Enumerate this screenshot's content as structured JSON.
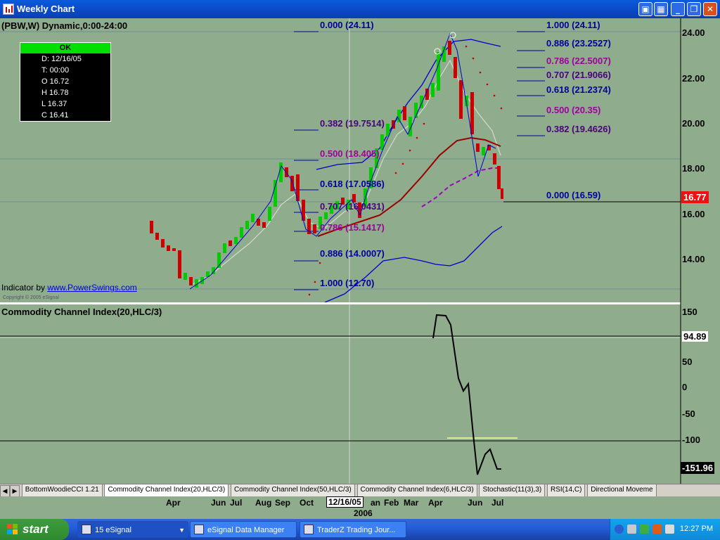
{
  "window": {
    "title": "Weekly Chart"
  },
  "chart": {
    "symbol_label": "(PBW,W) Dynamic,0:00-24:00",
    "indicator_credit": "Indicator by",
    "indicator_link": "www.PowerSwings.com",
    "copyright": "Copyright © 2005 eSignal",
    "ok_box": {
      "header": "OK",
      "lines": [
        "D: 12/16/05",
        "T: 00:00",
        "O 16.72",
        "H 16.78",
        "L 16.37",
        "C 16.41"
      ]
    },
    "price_axis_labels": [
      "24.00",
      "22.00",
      "20.00",
      "18.00",
      "16.00",
      "14.00"
    ],
    "current_price": "16.77",
    "fib_left": [
      {
        "label": "0.000 (24.11)",
        "color": "#0000A0"
      },
      {
        "label": "0.382 (19.7514)",
        "color": "#4B0082"
      },
      {
        "label": "0.500 (18.405)",
        "color": "#A000A0"
      },
      {
        "label": "0.618 (17.0586)",
        "color": "#0000A0"
      },
      {
        "label": "0.707 (16.0431)",
        "color": "#4B0082"
      },
      {
        "label": "0.786 (15.1417)",
        "color": "#A000A0"
      },
      {
        "label": "0.886 (14.0007)",
        "color": "#0000A0"
      },
      {
        "label": "1.000 (12.70)",
        "color": "#0000A0"
      }
    ],
    "fib_right": [
      {
        "label": "1.000 (24.11)",
        "color": "#0000A0"
      },
      {
        "label": "0.886 (23.2527)",
        "color": "#0000A0"
      },
      {
        "label": "0.786 (22.5007)",
        "color": "#A000A0"
      },
      {
        "label": "0.707 (21.9066)",
        "color": "#4B0082"
      },
      {
        "label": "0.618 (21.2374)",
        "color": "#0000A0"
      },
      {
        "label": "0.500 (20.35)",
        "color": "#A000A0"
      },
      {
        "label": "0.382 (19.4626)",
        "color": "#4B0082"
      },
      {
        "label": "0.000 (16.59)",
        "color": "#0000A0"
      }
    ]
  },
  "cci": {
    "title": "Commodity Channel Index(20,HLC/3)",
    "axis_labels": [
      "150",
      "50",
      "0",
      "-50",
      "-100"
    ],
    "ref_value": "94.89",
    "current_value": "-151.96"
  },
  "tabs": [
    {
      "label": "BottomWoodieCCI 1.21",
      "active": false
    },
    {
      "label": "Commodity Channel Index(20,HLC/3)",
      "active": true
    },
    {
      "label": "Commodity Channel Index(50,HLC/3)",
      "active": false
    },
    {
      "label": "Commodity Channel Index(6,HLC/3)",
      "active": false
    },
    {
      "label": "Stochastic(11(3),3)",
      "active": false
    },
    {
      "label": "RSI(14,C)",
      "active": false
    },
    {
      "label": "Directional Moveme",
      "active": false
    }
  ],
  "x_axis": {
    "months": [
      "Apr",
      "Jun",
      "Jul",
      "Aug",
      "Sep",
      "Oct",
      "an",
      "Feb",
      "Mar",
      "Apr",
      "Jun",
      "Jul"
    ],
    "cursor_date": "12/16/05",
    "year": "2006"
  },
  "taskbar": {
    "start_label": "start",
    "tasks": [
      {
        "label": "15 eSignal",
        "active": true
      },
      {
        "label": "eSignal Data Manager",
        "active": false
      },
      {
        "label": "TraderZ Trading Jour...",
        "active": false
      }
    ],
    "clock": "12:27 PM"
  },
  "colors": {
    "background": "#8FAC8C",
    "up_candle": "#00CC00",
    "down_candle": "#CC0000",
    "ma_red": "#990000",
    "bollinger": "#0000CC",
    "fib_blue": "#0000A0",
    "fib_purple": "#A000A0"
  },
  "icons": [
    "chart-app-icon",
    "minimize-icon",
    "maximize-icon",
    "close-icon",
    "windows-flag-icon",
    "volume-icon"
  ]
}
